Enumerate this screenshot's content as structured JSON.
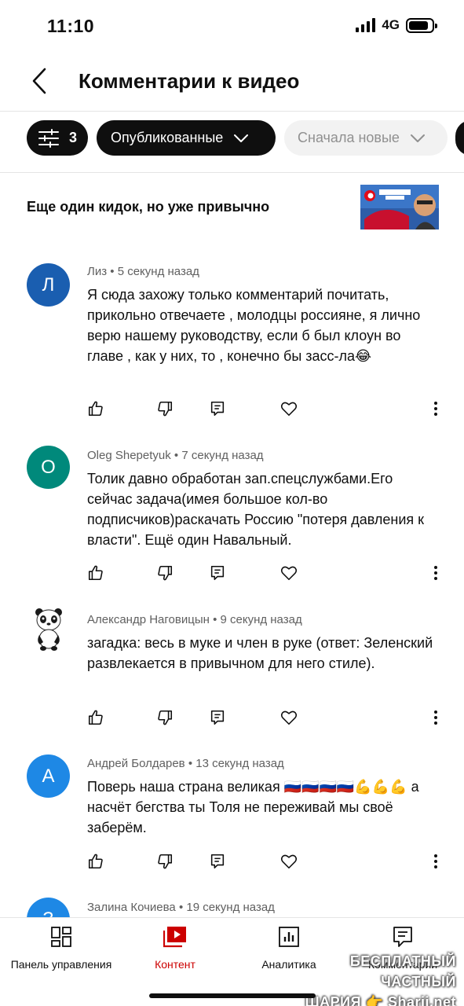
{
  "status_bar": {
    "time": "11:10",
    "network": "4G"
  },
  "header": {
    "title": "Комментарии к видео",
    "back_icon": "chevron-left-icon"
  },
  "filters": {
    "count": "3",
    "published_label": "Опубликованные",
    "sort_label": "Сначала новые"
  },
  "video": {
    "title": "Еще один кидок, но уже привычно"
  },
  "comments": [
    {
      "initial": "Л",
      "avatar_color": "#1a5eb0",
      "author": "Лиз",
      "time": "5 секунд назад",
      "text": "Я сюда захожу только комментарий почитать, прикольно отвечаете , молодцы россияне, я лично верю нашему руководству, если б был клоун во главе , как у них, то , конечно бы засс-ла😂"
    },
    {
      "initial": "O",
      "avatar_color": "#00897b",
      "author": "Oleg Shepetyuk",
      "time": "7 секунд назад",
      "text": "Толик давно обработан зап.спецслужбами.Его сейчас задача(имея большое кол-во подписчиков)раскачать Россию \"потеря давления к власти\". Ещё один Навальный."
    },
    {
      "initial": "",
      "avatar_color": "#ffffff",
      "author": "Александр Наговицын",
      "time": "9 секунд назад",
      "text": "загадка: весь в муке и член в руке (ответ: Зеленский развлекается в привычном для него стиле)."
    },
    {
      "initial": "А",
      "avatar_color": "#1e88e5",
      "author": "Андрей Болдарев",
      "time": "13 секунд назад",
      "text": "Поверь наша страна великая 🇷🇺🇷🇺🇷🇺🇷🇺💪💪💪 а насчёт бегства ты Толя не переживай мы своё заберём."
    },
    {
      "initial": "З",
      "avatar_color": "#1e88e5",
      "author": "Залина Кочиева",
      "time": "19 секунд назад",
      "text": ""
    }
  ],
  "bottom_nav": [
    {
      "label": "Панель управления",
      "icon": "dashboard-icon",
      "active": false
    },
    {
      "label": "Контент",
      "icon": "content-icon",
      "active": true
    },
    {
      "label": "Аналитика",
      "icon": "analytics-icon",
      "active": false
    },
    {
      "label": "Комментарии",
      "icon": "comments-icon",
      "active": false
    }
  ],
  "watermark": {
    "line1": "БЕСПЛАТНЫЙ ЧАСТНЫЙ",
    "line2": "ШАРИЯ 👉 Sharij.net"
  },
  "colors": {
    "accent_red": "#cc0000",
    "chip_dark": "#0f0f0f",
    "chip_light": "#f2f2f2"
  }
}
